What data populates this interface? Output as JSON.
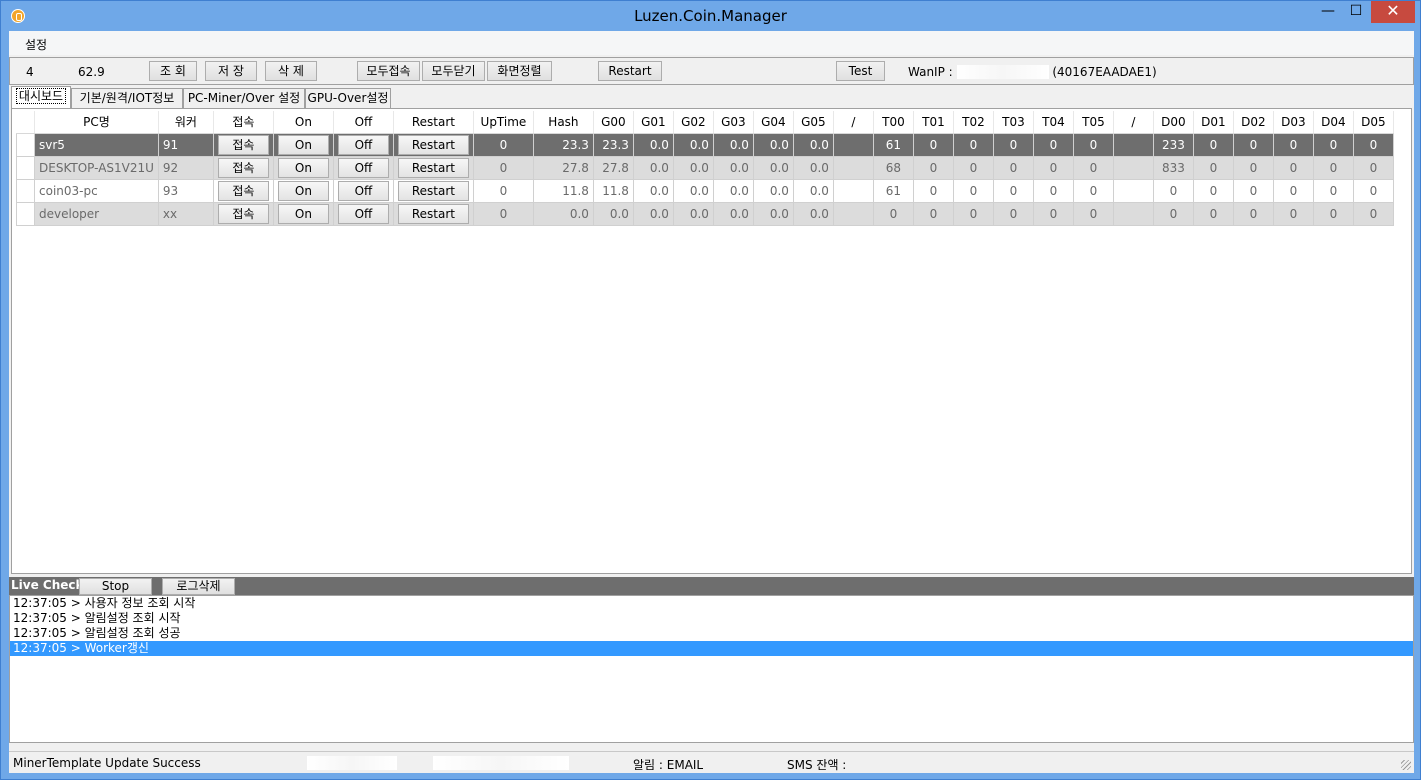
{
  "window": {
    "title": "Luzen.Coin.Manager",
    "minimize": "—",
    "maximize": "☐",
    "close": "✕"
  },
  "menu": {
    "settings": "설정"
  },
  "toolbar": {
    "count": "4",
    "version": "62.9",
    "query_btn": "조 회",
    "save_btn": "저 장",
    "delete_btn": "삭 제",
    "connect_all_btn": "모두접속",
    "close_all_btn": "모두닫기",
    "arrange_btn": "화면정렬",
    "restart_btn": "Restart",
    "test_btn": "Test",
    "wanip_label": "WanIP : ",
    "wanip_suffix": "(40167EAADAE1)"
  },
  "tabs": [
    "대시보드",
    "기본/원격/IOT정보",
    "PC-Miner/Over 설정",
    "GPU-Over설정"
  ],
  "grid": {
    "columns": [
      "PC명",
      "워커",
      "접속",
      "On",
      "Off",
      "Restart",
      "UpTime",
      "Hash",
      "G00",
      "G01",
      "G02",
      "G03",
      "G04",
      "G05",
      "/",
      "T00",
      "T01",
      "T02",
      "T03",
      "T04",
      "T05",
      "/",
      "D00",
      "D01",
      "D02",
      "D03",
      "D04",
      "D05"
    ],
    "button_labels": {
      "connect": "접속",
      "on": "On",
      "off": "Off",
      "restart": "Restart"
    },
    "rows": [
      {
        "pc": "svr5",
        "worker": "91",
        "uptime": "0",
        "hash": "23.3",
        "g": [
          "23.3",
          "0.0",
          "0.0",
          "0.0",
          "0.0",
          "0.0"
        ],
        "t": [
          "61",
          "0",
          "0",
          "0",
          "0",
          "0"
        ],
        "d": [
          "233",
          "0",
          "0",
          "0",
          "0",
          "0"
        ]
      },
      {
        "pc": "DESKTOP-AS1V21U",
        "worker": "92",
        "uptime": "0",
        "hash": "27.8",
        "g": [
          "27.8",
          "0.0",
          "0.0",
          "0.0",
          "0.0",
          "0.0"
        ],
        "t": [
          "68",
          "0",
          "0",
          "0",
          "0",
          "0"
        ],
        "d": [
          "833",
          "0",
          "0",
          "0",
          "0",
          "0"
        ]
      },
      {
        "pc": "coin03-pc",
        "worker": "93",
        "uptime": "0",
        "hash": "11.8",
        "g": [
          "11.8",
          "0.0",
          "0.0",
          "0.0",
          "0.0",
          "0.0"
        ],
        "t": [
          "61",
          "0",
          "0",
          "0",
          "0",
          "0"
        ],
        "d": [
          "0",
          "0",
          "0",
          "0",
          "0",
          "0"
        ]
      },
      {
        "pc": "developer",
        "worker": "xx",
        "uptime": "0",
        "hash": "0.0",
        "g": [
          "0.0",
          "0.0",
          "0.0",
          "0.0",
          "0.0",
          "0.0"
        ],
        "t": [
          "0",
          "0",
          "0",
          "0",
          "0",
          "0"
        ],
        "d": [
          "0",
          "0",
          "0",
          "0",
          "0",
          "0"
        ]
      }
    ]
  },
  "log": {
    "live_check": "Live Check",
    "stop_btn": "Stop",
    "clear_btn": "로그삭제",
    "lines": [
      "12:37:05 > 사용자 정보 조회 시작",
      "12:37:05 > 알림설정 조회 시작",
      "12:37:05 > 알림설정 조회 성공",
      "12:37:05 > Worker갱신"
    ]
  },
  "status": {
    "message": "MinerTemplate Update Success",
    "alert": "알림 : EMAIL",
    "sms": "SMS 잔액 :"
  }
}
